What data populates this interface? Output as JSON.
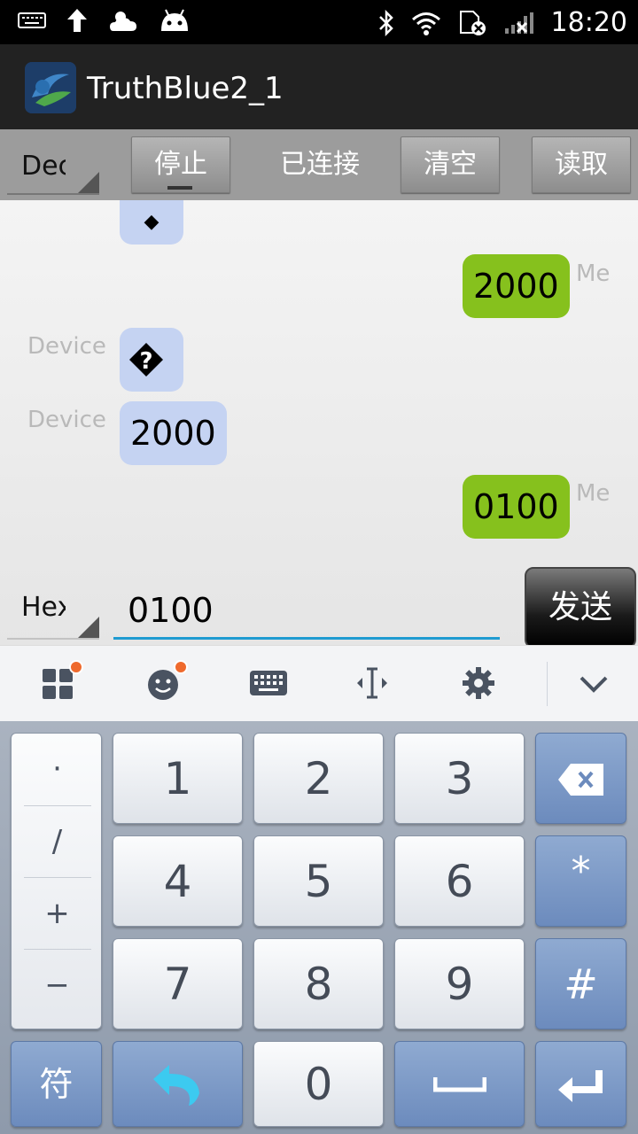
{
  "status_bar": {
    "time": "18:20",
    "icons": [
      "keyboard-icon",
      "upload-icon",
      "weather-icon",
      "android-icon",
      "bluetooth-icon",
      "wifi-icon",
      "sim-icon",
      "signal-icon"
    ]
  },
  "app": {
    "title": "TruthBlue2_1"
  },
  "toolbar": {
    "mode_spinner": "Dec",
    "stop_button": "停止",
    "status_label": "已连接",
    "clear_button": "清空",
    "read_button": "读取"
  },
  "messages": [
    {
      "sender": "Device",
      "text": "◆",
      "partial": true
    },
    {
      "sender": "Me",
      "text": "2000"
    },
    {
      "sender": "Device",
      "text": "◆"
    },
    {
      "sender": "Device",
      "text": "2000"
    },
    {
      "sender": "Me",
      "text": "0100"
    }
  ],
  "input": {
    "format_spinner": "Hex",
    "value": "0100",
    "send_button": "发送"
  },
  "ime": {
    "icons": [
      "apps-icon",
      "emoji-icon",
      "keyboard-icon",
      "cursor-icon",
      "settings-icon",
      "collapse-icon"
    ]
  },
  "keyboard": {
    "symbols": [
      "·",
      "/",
      "+",
      "−"
    ],
    "digits": [
      "1",
      "2",
      "3",
      "4",
      "5",
      "6",
      "7",
      "8",
      "9",
      "0"
    ],
    "star": "*",
    "hash": "#",
    "symbol_key": "符"
  },
  "colors": {
    "me_bubble": "#86c11d",
    "device_bubble": "#c5d3f2",
    "input_underline": "#1f9bd1"
  }
}
